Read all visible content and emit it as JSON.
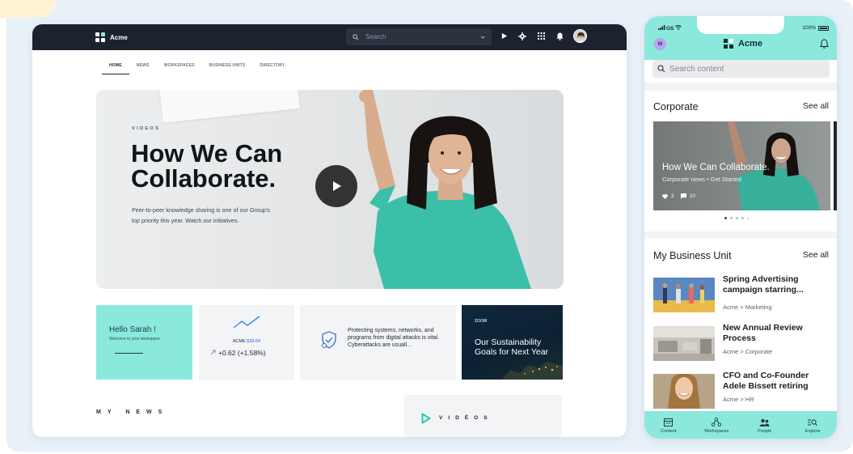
{
  "colors": {
    "accent_mint": "#8be8dc",
    "topbar_dark": "#1d232e",
    "link_blue": "#2563eb",
    "zoom_card_navy": "#10283d",
    "avatar_purple": "#b8a4f0"
  },
  "desktop": {
    "brand": "Acme",
    "search": {
      "placeholder": "Search"
    },
    "topbar_icons": [
      "play-icon",
      "gear-icon",
      "grid-icon",
      "bell-icon",
      "avatar"
    ],
    "nav_tabs": [
      {
        "label": "HOME",
        "active": true
      },
      {
        "label": "NEWS"
      },
      {
        "label": "WORKSPACES"
      },
      {
        "label": "BUSINESS UNITS"
      },
      {
        "label": "DIRECTORY"
      }
    ],
    "hero": {
      "kicker": "VIDEOS",
      "title": "How We Can Collaborate.",
      "body": "Peer-to-peer knowledge sharing is one of our Group's top priority this year. Watch our initiatives."
    },
    "cards": {
      "hello": {
        "title": "Hello Sarah !",
        "subtitle": "Welcome to your workspace"
      },
      "stock": {
        "ticker": "ACME",
        "price": "$39.64",
        "change": "+0.62 (+1.58%)"
      },
      "security": {
        "text": "Protecting systems, networks, and programs from digital attacks is vital. Cyberattacks are usuall..."
      },
      "zoom": {
        "kicker": "ZOOM",
        "title": "Our Sustainability Goals for Next Year"
      }
    },
    "sections": {
      "my_news": "MY NEWS",
      "videos": "VIDÉOS"
    }
  },
  "phone": {
    "status": {
      "carrier": "GS",
      "battery": "100%"
    },
    "avatar_initial": "M",
    "brand": "Acme",
    "search": {
      "placeholder": "Search content"
    },
    "corporate": {
      "heading": "Corporate",
      "see_all": "See all",
      "card": {
        "title": "How We Can Collaborate.",
        "meta": "Corporate news • Get Started",
        "likes": "3",
        "comments": "10"
      },
      "carousel_dots": 5,
      "carousel_active": 0
    },
    "business_unit": {
      "heading": "My Business Unit",
      "see_all": "See all",
      "items": [
        {
          "title": "Spring Advertising campaign starring...",
          "path": "Acme > Marketing"
        },
        {
          "title": "New Annual Review Process",
          "path": "Acme > Corporate"
        },
        {
          "title": "CFO and Co-Founder Adele Bissett retiring",
          "path": "Acme > HR"
        }
      ]
    },
    "tabs": [
      {
        "label": "Content",
        "icon": "content-icon"
      },
      {
        "label": "Workspaces",
        "icon": "workspaces-icon"
      },
      {
        "label": "People",
        "icon": "people-icon"
      },
      {
        "label": "Explore",
        "icon": "explore-icon"
      }
    ]
  }
}
